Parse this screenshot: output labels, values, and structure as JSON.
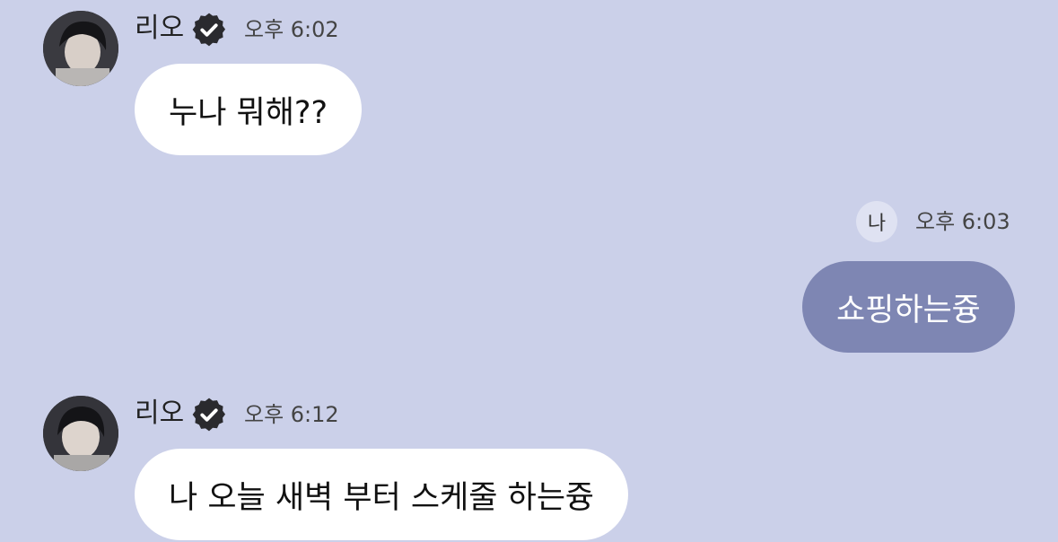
{
  "messages": [
    {
      "sender": "리오",
      "verified": true,
      "time": "오후 6:02",
      "text": "누나 뭐해??",
      "side": "left"
    },
    {
      "sender": "나",
      "time": "오후 6:03",
      "text": "쇼핑하는즁",
      "side": "right"
    },
    {
      "sender": "리오",
      "verified": true,
      "time": "오후 6:12",
      "text": "나 오늘 새벽 부터 스케줄 하는즁",
      "side": "left"
    }
  ],
  "colors": {
    "background": "#cbd0e9",
    "incoming_bubble": "#ffffff",
    "outgoing_bubble": "#7e86b3",
    "verified_badge": "#2a2a2e"
  }
}
